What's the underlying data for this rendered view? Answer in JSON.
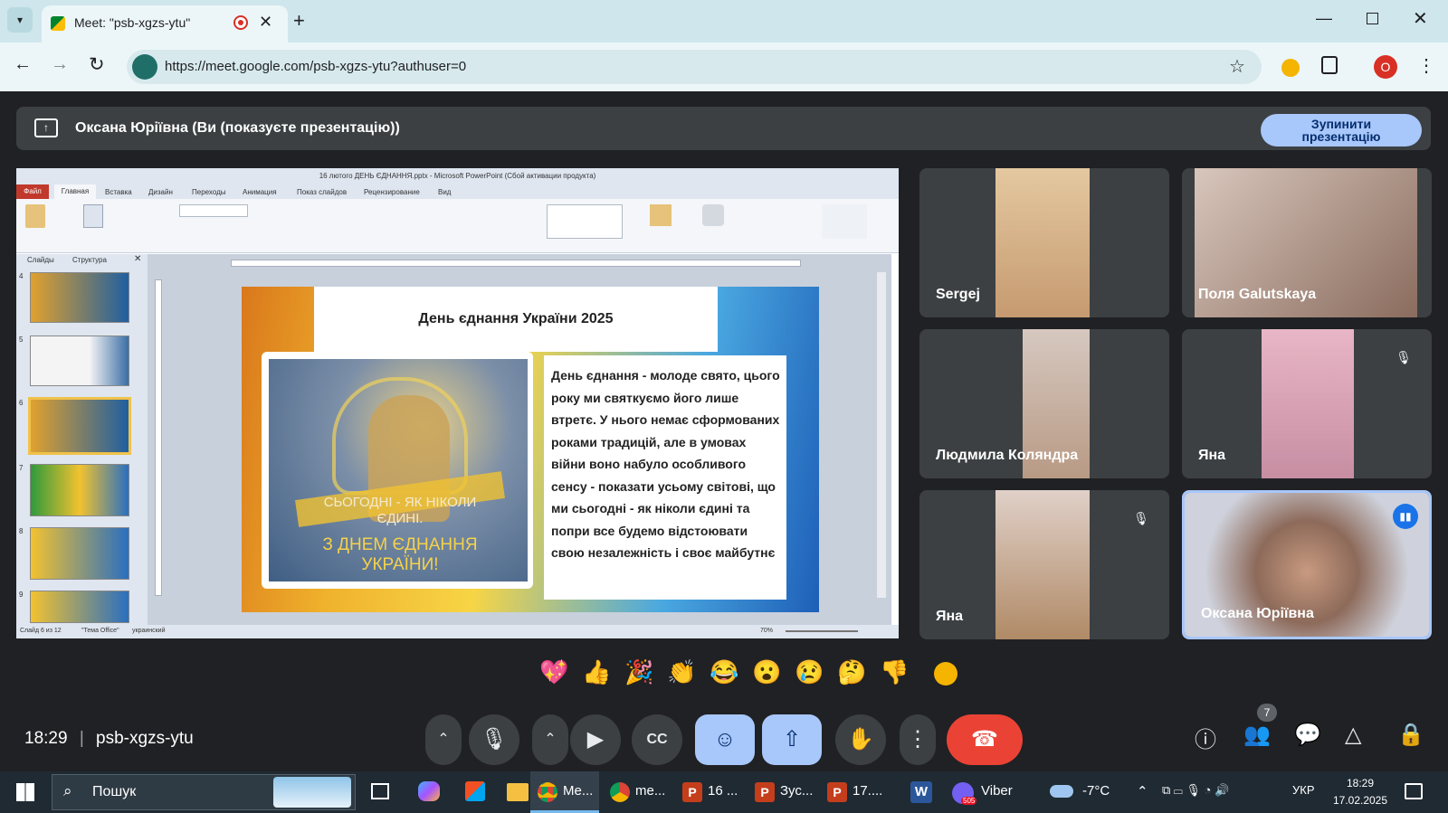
{
  "browser": {
    "tab_title": "Meet: \"psb-xgzs-ytu\"",
    "url": "https://meet.google.com/psb-xgzs-ytu?authuser=0",
    "profile_initial": "O"
  },
  "presentation_bar": {
    "text": "Оксана Юріївна (Ви (показуєте презентацію))",
    "stop_line1": "Зупинити",
    "stop_line2": "презентацію"
  },
  "shared_screen": {
    "window_title": "16 лютого ДЕНЬ ЄДНАННЯ.pptx - Microsoft PowerPoint (Сбой активации продукта)",
    "ribbon_tabs": [
      "Файл",
      "Главная",
      "Вставка",
      "Дизайн",
      "Переходы",
      "Анимация",
      "Показ слайдов",
      "Рецензирование",
      "Вид"
    ],
    "panel_tabs": [
      "Слайды",
      "Структура"
    ],
    "thumb_numbers": [
      "4",
      "5",
      "6",
      "7",
      "8",
      "9"
    ],
    "slide_title": "День єднання України 2025",
    "slide_text": "День єднання - молоде свято, цього року ми святкуємо його лише втретє. У нього немає сформованих роками традицій, але в умовах війни воно набуло особливого сенсу - показати усьому світові, що ми сьогодні - як ніколи єдині та попри все будемо відстоювати свою незалежність і своє майбутнє",
    "image_caption1": "СЬОГОДНІ - ЯК НІКОЛИ ЄДИНІ.",
    "image_caption2": "З ДНЕМ ЄДНАННЯ УКРАЇНИ!",
    "status_slide": "Слайд 6 из 12",
    "status_theme": "\"Тема Office\"",
    "status_lang": "украинский",
    "zoom": "70%"
  },
  "participants": [
    {
      "name": "Sergej",
      "muted": false
    },
    {
      "name": "Поля Galutskaya",
      "muted": false
    },
    {
      "name": "Людмила Коляндра",
      "muted": false
    },
    {
      "name": "Яна",
      "muted": true
    },
    {
      "name": "Яна",
      "muted": true
    },
    {
      "name": "Оксана Юріївна",
      "muted": false,
      "speaking": true
    }
  ],
  "reactions": [
    "💖",
    "👍",
    "🎉",
    "👏",
    "😂",
    "😮",
    "😢",
    "🤔",
    "👎"
  ],
  "meeting": {
    "time": "18:29",
    "code": "psb-xgzs-ytu",
    "people_count": "7"
  },
  "taskbar": {
    "search_placeholder": "Пошук",
    "apps": [
      "Me...",
      "me...",
      "16 ...",
      "Зус...",
      "17....",
      "Viber"
    ],
    "viber_badge": "505",
    "weather": "-7°C",
    "lang": "УКР",
    "time": "18:29",
    "date": "17.02.2025"
  },
  "colors": {
    "meet_bg": "#202124",
    "accent": "#a8c7fa",
    "hangup": "#ea4335"
  }
}
